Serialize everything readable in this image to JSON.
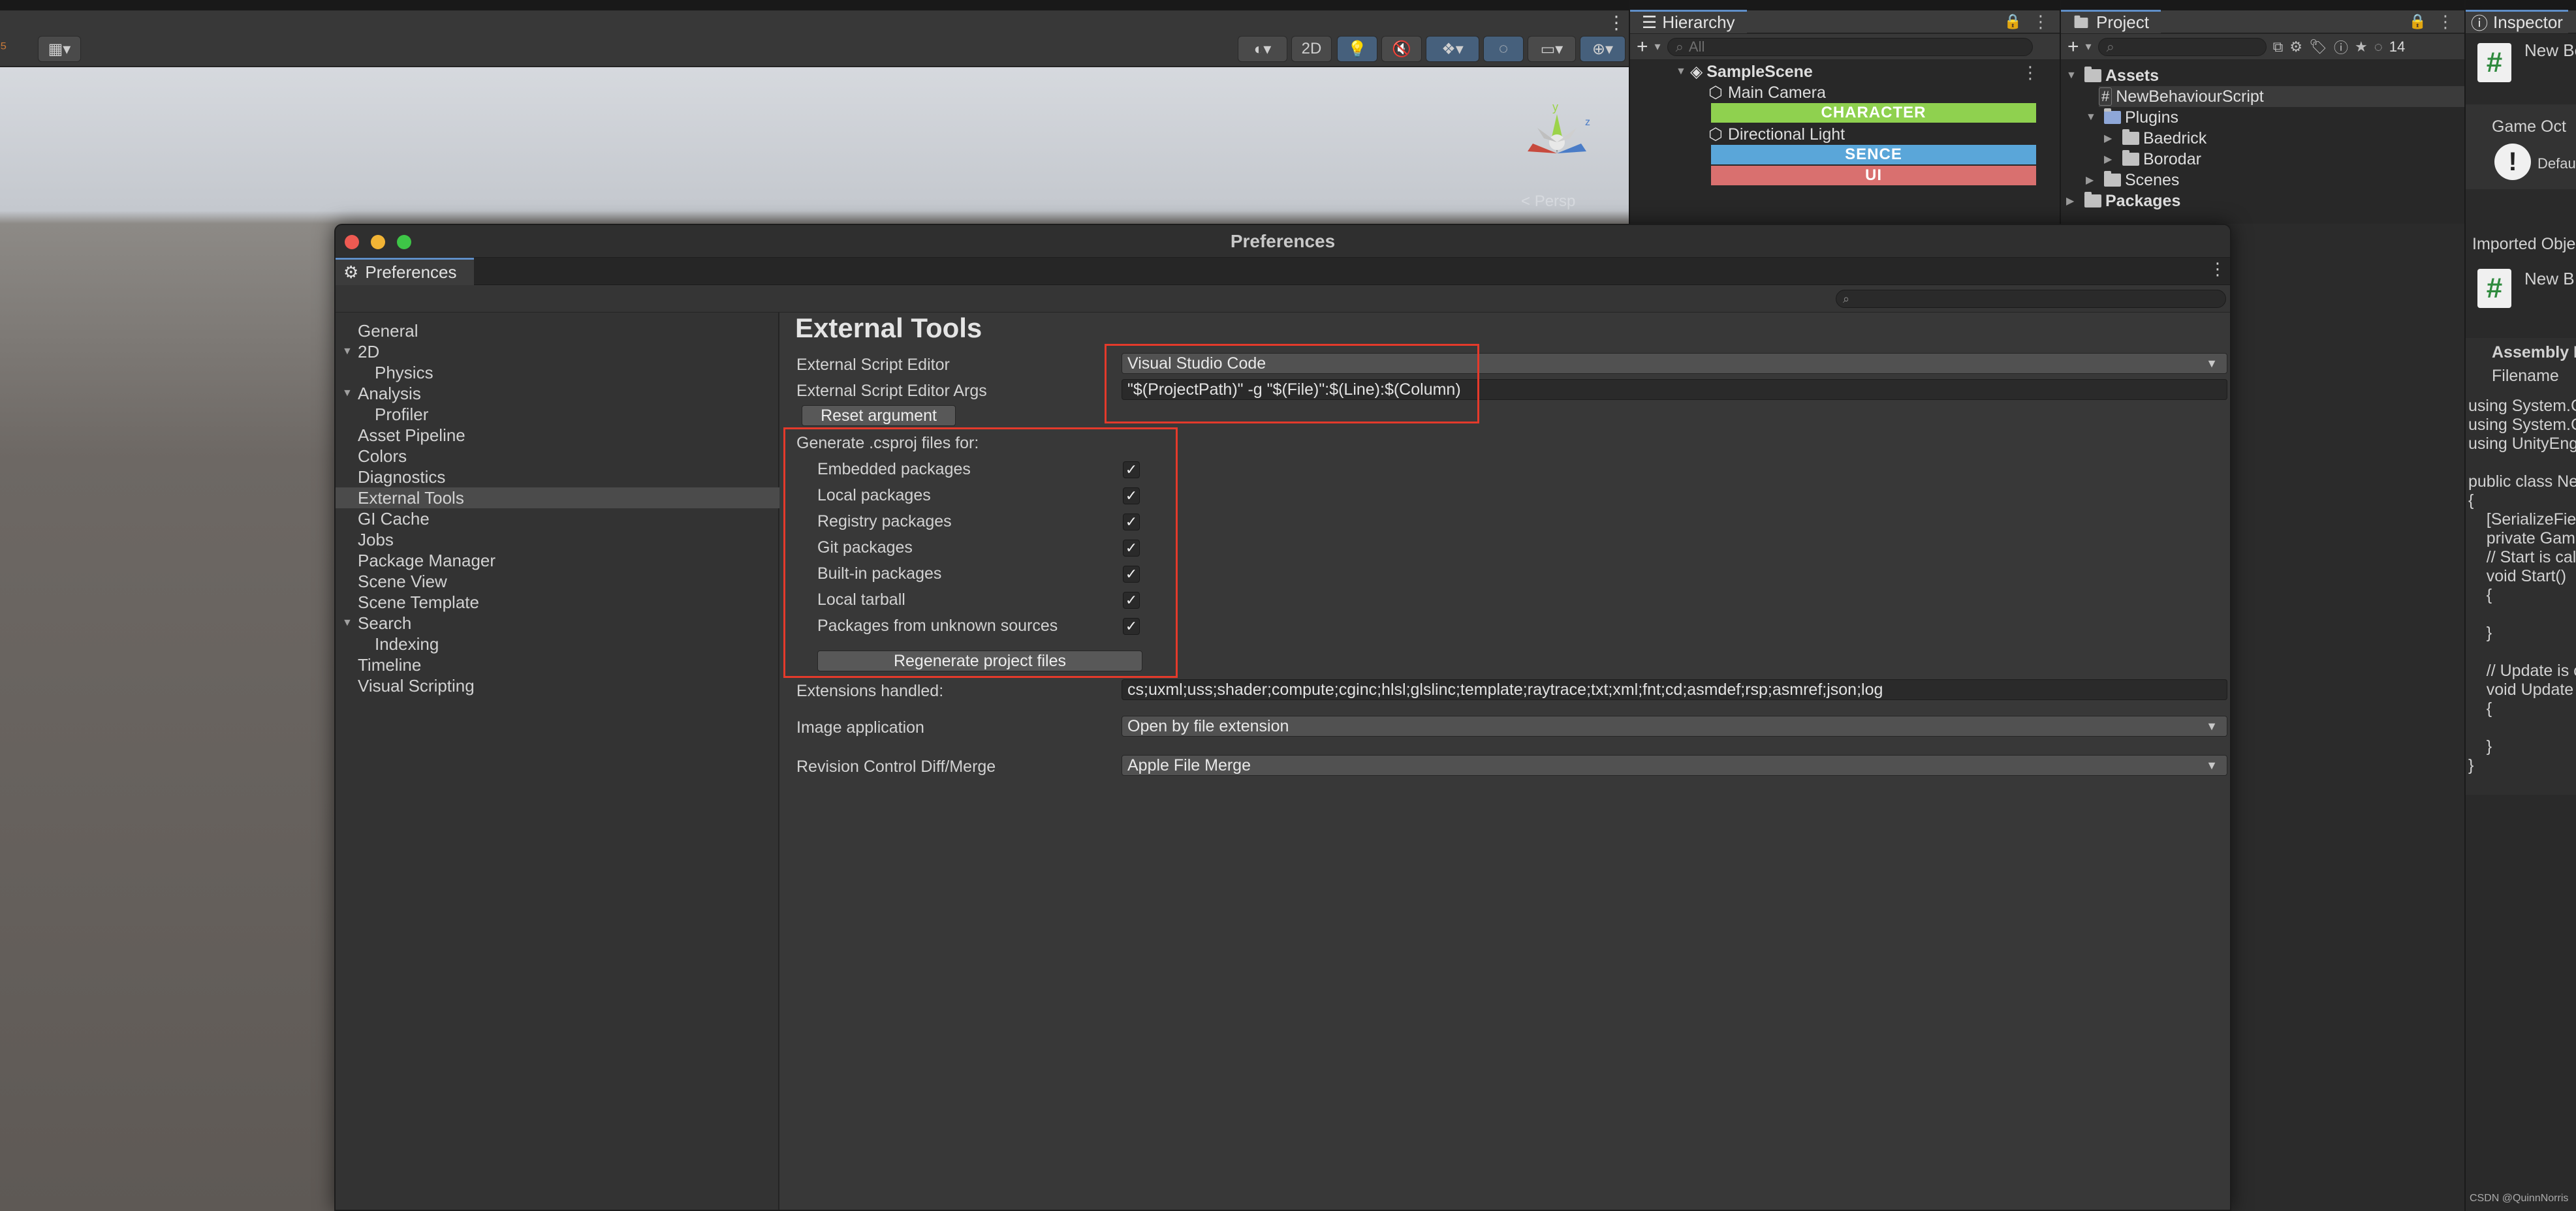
{
  "scene": {
    "toolbar": {
      "mode_2d": "2D"
    },
    "gizmo_label": "Persp",
    "gizmo_axis_y": "y",
    "gizmo_axis_z": "z"
  },
  "hierarchy": {
    "tab_label": "Hierarchy",
    "search_placeholder": "All",
    "add_label": "+",
    "scene_name": "SampleScene",
    "items": [
      {
        "label": "Main Camera"
      },
      {
        "label": "CHARACTER",
        "color": "#8fd14f"
      },
      {
        "label": "Directional Light"
      },
      {
        "label": "SENCE",
        "color": "#5aa6d9"
      },
      {
        "label": "UI",
        "color": "#d9706f"
      }
    ]
  },
  "project": {
    "tab_label": "Project",
    "add_label": "+",
    "hidden_count": "14",
    "tree": [
      {
        "label": "Assets"
      },
      {
        "label": "NewBehaviourScript"
      },
      {
        "label": "Plugins"
      },
      {
        "label": "Baedrick"
      },
      {
        "label": "Borodar"
      },
      {
        "label": "Scenes"
      },
      {
        "label": "Packages"
      }
    ]
  },
  "inspector": {
    "tab_label": "Inspector",
    "asset_name": "New Be",
    "game_object_label": "Game Oct",
    "default_label": "Defau",
    "imported_objects_label": "Imported Objec",
    "imported_name": "New B",
    "assembly_label": "Assembly I",
    "filename_label": "Filename",
    "code_lines": [
      "using System.C",
      "using System.C",
      "using UnityEng",
      "",
      "public class Ne",
      "{",
      "    [SerializeFie",
      "    private Game",
      "    // Start is cal",
      "    void Start()",
      "    {",
      "",
      "    }",
      "",
      "    // Update is c",
      "    void Update",
      "    {",
      "",
      "    }",
      "}"
    ],
    "watermark": "CSDN @QuinnNorris"
  },
  "preferences": {
    "title": "Preferences",
    "tab_label": "Preferences",
    "sidebar": [
      {
        "label": "General",
        "indent": 0
      },
      {
        "label": "2D",
        "indent": 0,
        "expanded": true
      },
      {
        "label": "Physics",
        "indent": 1
      },
      {
        "label": "Analysis",
        "indent": 0,
        "expanded": true
      },
      {
        "label": "Profiler",
        "indent": 1
      },
      {
        "label": "Asset Pipeline",
        "indent": 0
      },
      {
        "label": "Colors",
        "indent": 0
      },
      {
        "label": "Diagnostics",
        "indent": 0
      },
      {
        "label": "External Tools",
        "indent": 0,
        "selected": true
      },
      {
        "label": "GI Cache",
        "indent": 0
      },
      {
        "label": "Jobs",
        "indent": 0
      },
      {
        "label": "Package Manager",
        "indent": 0
      },
      {
        "label": "Scene View",
        "indent": 0
      },
      {
        "label": "Scene Template",
        "indent": 0
      },
      {
        "label": "Search",
        "indent": 0,
        "expanded": true
      },
      {
        "label": "Indexing",
        "indent": 1
      },
      {
        "label": "Timeline",
        "indent": 0
      },
      {
        "label": "Visual Scripting",
        "indent": 0
      }
    ],
    "content": {
      "heading": "External Tools",
      "script_editor_label": "External Script Editor",
      "script_editor_value": "Visual Studio Code",
      "script_args_label": "External Script Editor Args",
      "script_args_value": "\"$(ProjectPath)\" -g \"$(File)\":$(Line):$(Column)",
      "reset_button": "Reset argument",
      "csproj_heading": "Generate .csproj files for:",
      "packages": [
        {
          "label": "Embedded packages",
          "checked": true
        },
        {
          "label": "Local packages",
          "checked": true
        },
        {
          "label": "Registry packages",
          "checked": true
        },
        {
          "label": "Git packages",
          "checked": true
        },
        {
          "label": "Built-in packages",
          "checked": true
        },
        {
          "label": "Local tarball",
          "checked": true
        },
        {
          "label": "Packages from unknown sources",
          "checked": true
        }
      ],
      "regenerate_button": "Regenerate project files",
      "extensions_label": "Extensions handled:",
      "extensions_value": "cs;uxml;uss;shader;compute;cginc;hlsl;glslinc;template;raytrace;txt;xml;fnt;cd;asmdef;rsp;asmref;json;log",
      "image_app_label": "Image application",
      "image_app_value": "Open by file extension",
      "revision_label": "Revision Control Diff/Merge",
      "revision_value": "Apple File Merge"
    }
  },
  "colors": {
    "highlight_red": "#e43a2b",
    "tab_accent": "#5f8ec7"
  }
}
